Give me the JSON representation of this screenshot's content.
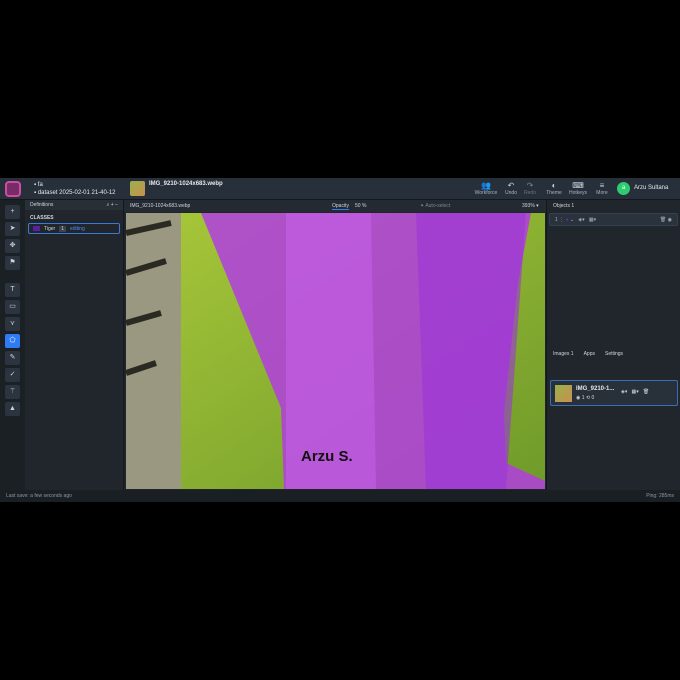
{
  "header": {
    "folder": "fa",
    "dataset": "dataset 2025-02-01 21-40-12",
    "image_title": "IMG_9210-1024x683.webp",
    "buttons": [
      {
        "label": "Workforce",
        "icon": "users-icon"
      },
      {
        "label": "Undo",
        "icon": "undo-icon"
      },
      {
        "label": "Redo",
        "icon": "redo-icon"
      },
      {
        "label": "Theme",
        "icon": "theme-icon"
      },
      {
        "label": "Hotkeys",
        "icon": "keyboard-icon"
      },
      {
        "label": "More",
        "icon": "menu-icon"
      }
    ],
    "user_initial": "a",
    "user_name": "Arzu Sultana"
  },
  "definitions": {
    "tab": "Definitions",
    "classes_label": "CLASSES",
    "class_name": "Tiger",
    "class_count": "1",
    "class_tag": "editing",
    "class_color": "#5b1fa0"
  },
  "canvasbar": {
    "filename": "IMG_9210-1024x683.webp",
    "opacity_label": "Opacity",
    "opacity_value": "50",
    "percent": "%",
    "auto_select": "Auto-select",
    "zoom": "393%"
  },
  "canvas": {
    "watermark": "Arzu S."
  },
  "objects": {
    "tab": "Objects",
    "count": "1",
    "row_index": "1"
  },
  "images": {
    "tabs": [
      "Images",
      "Apps",
      "Settings"
    ],
    "count": "1",
    "item_name": "IMG_9210-1...",
    "item_objects": "1",
    "item_tags": "0"
  },
  "status": {
    "left": "Last save: a few seconds ago",
    "right": "Ping: 285ms"
  }
}
